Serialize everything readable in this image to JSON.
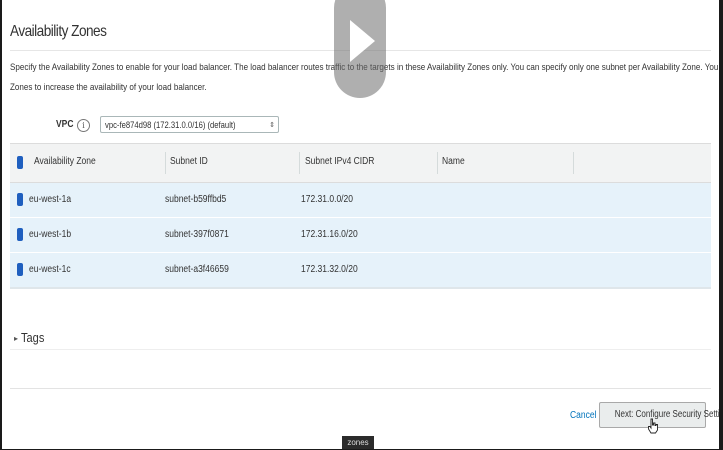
{
  "page": {
    "title": "Availability Zones",
    "description_line1": "Specify the Availability Zones to enable for your load balancer. The load balancer routes traffic to the targets in these Availability Zones only. You can specify only one subnet per Availability Zone. You must specify subnets from at least two Availability",
    "description_line2": "Zones to increase the availability of your load balancer."
  },
  "vpc": {
    "label": "VPC",
    "info_glyph": "i",
    "value": "vpc-fe874d98 (172.31.0.0/16) (default)"
  },
  "table": {
    "headers": [
      "Availability Zone",
      "Subnet ID",
      "Subnet IPv4 CIDR",
      "Name"
    ],
    "rows": [
      {
        "zone": "eu-west-1a",
        "subnet": "subnet-b59ffbd5",
        "cidr": "172.31.0.0/20",
        "name": ""
      },
      {
        "zone": "eu-west-1b",
        "subnet": "subnet-397f0871",
        "cidr": "172.31.16.0/20",
        "name": ""
      },
      {
        "zone": "eu-west-1c",
        "subnet": "subnet-a3f46659",
        "cidr": "172.31.32.0/20",
        "name": ""
      }
    ]
  },
  "tags": {
    "label": "Tags",
    "caret": "▸"
  },
  "footer": {
    "cancel_label": "Cancel",
    "next_label": "Next: Configure Security Settings"
  },
  "overlay": {
    "bottom_label": "zones"
  },
  "colors": {
    "accent": "#0073bb",
    "checkbox": "#1f5fbf",
    "row_selected": "#e6f2fa"
  }
}
